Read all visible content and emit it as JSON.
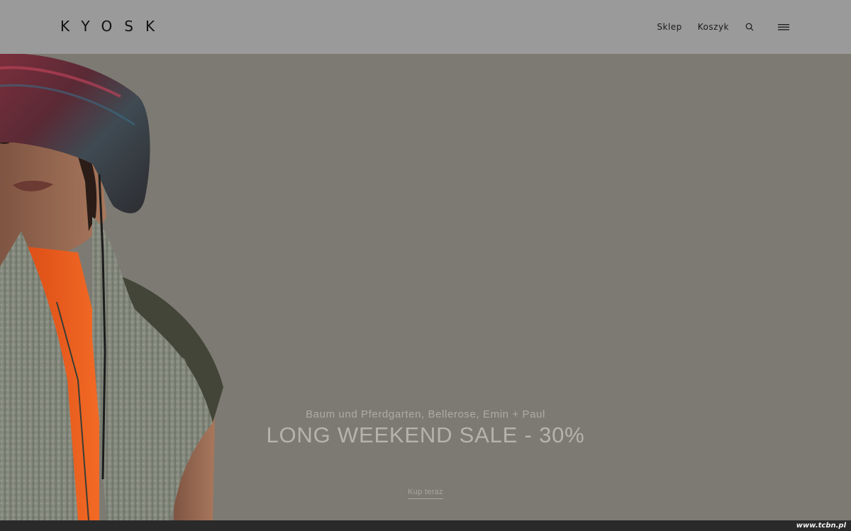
{
  "header": {
    "logo": "KYOSK",
    "nav": {
      "shop_label": "Sklep",
      "cart_label": "Koszyk",
      "search_icon": "search-icon",
      "menu_icon": "hamburger-menu-icon"
    }
  },
  "hero": {
    "subtitle": "Baum und Pferdgarten, Bellerose, Emin + Paul",
    "title": "LONG WEEKEND SALE - 30%",
    "cta_label": "Kup teraz",
    "image": "model-in-bucket-hat-and-fleece-vest-photo"
  },
  "watermark": "www.tcbn.pl",
  "colors": {
    "header_bg": "#9a9a9a",
    "hero_bg": "#7d7a73",
    "hero_text": "#b6b3ad",
    "footer_bg": "#2a2a2a"
  }
}
